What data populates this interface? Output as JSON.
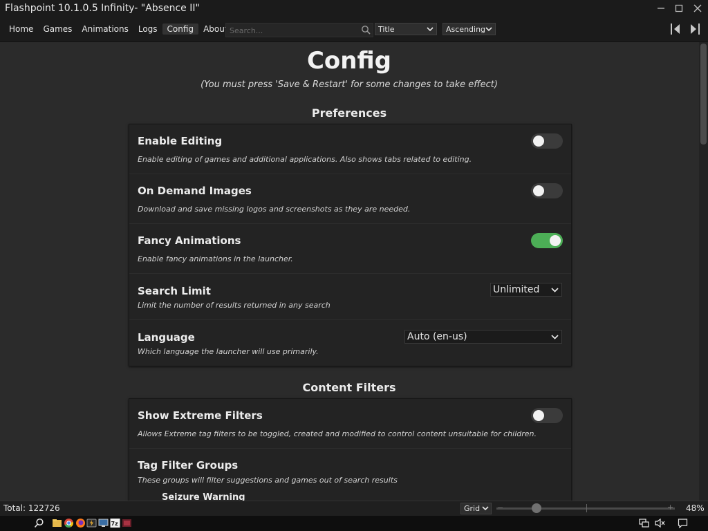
{
  "window": {
    "title": "Flashpoint 10.1.0.5 Infinity- \"Absence II\"",
    "controls": [
      "minimize",
      "maximize",
      "close"
    ]
  },
  "nav": {
    "items": [
      {
        "label": "Home",
        "active": false
      },
      {
        "label": "Games",
        "active": false
      },
      {
        "label": "Animations",
        "active": false
      },
      {
        "label": "Logs",
        "active": false
      },
      {
        "label": "Config",
        "active": true
      },
      {
        "label": "About",
        "active": false
      }
    ],
    "search_placeholder": "Search...",
    "order_by": "Title",
    "order_dir": "Ascending"
  },
  "page": {
    "title": "Config",
    "note": "(You must press 'Save & Restart' for some changes to take effect)"
  },
  "preferences": {
    "heading": "Preferences",
    "enable_editing": {
      "title": "Enable Editing",
      "desc": "Enable editing of games and additional applications. Also shows tabs related to editing.",
      "on": false
    },
    "on_demand_images": {
      "title": "On Demand Images",
      "desc": "Download and save missing logos and screenshots as they are needed.",
      "on": false
    },
    "fancy_animations": {
      "title": "Fancy Animations",
      "desc": "Enable fancy animations in the launcher.",
      "on": true
    },
    "search_limit": {
      "title": "Search Limit",
      "desc": "Limit the number of results returned in any search",
      "value": "Unlimited"
    },
    "language": {
      "title": "Language",
      "desc": "Which language the launcher will use primarily.",
      "value": "Auto (en-us)"
    }
  },
  "content_filters": {
    "heading": "Content Filters",
    "show_extreme": {
      "title": "Show Extreme Filters",
      "desc": "Allows Extreme tag filters to be toggled, created and modified to control content unsuitable for children.",
      "on": false
    },
    "tag_filter_groups": {
      "title": "Tag Filter Groups",
      "desc": "These groups will filter suggestions and games out of search results",
      "first_group": "Seizure Warning"
    }
  },
  "status": {
    "total": "Total: 122726",
    "layout": "Grid",
    "zoom_level": 0.48,
    "zoom_pct": "48%"
  },
  "taskbar": {
    "icons": [
      "search-icon",
      "file-explorer-icon",
      "chrome-icon",
      "firefox-icon",
      "flashpoint-icon",
      "monitor-icon",
      "7zip-icon",
      "app-icon"
    ],
    "tray": [
      "network-icon",
      "volume-muted-icon",
      "notifications-icon"
    ]
  },
  "colors": {
    "toggle_on": "#4cae56",
    "toggle_off": "#3b3b3b",
    "background": "#2b2b2b",
    "panel": "#232323"
  }
}
